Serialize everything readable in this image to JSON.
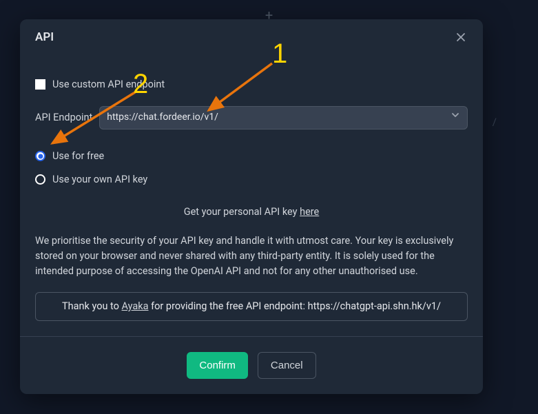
{
  "background": {
    "plus": "+",
    "right_fragment": "/"
  },
  "modal": {
    "title": "API",
    "checkbox_label": "Use custom API endpoint",
    "endpoint_label": "API Endpoint",
    "endpoint_value": "https://chat.fordeer.io/v1/",
    "radio_free": "Use for free",
    "radio_own": "Use your own API key",
    "get_key_text": "Get your personal API key ",
    "get_key_link": "here",
    "desc": "We prioritise the security of your API key and handle it with utmost care. Your key is exclusively stored on your browser and never shared with any third-party entity. It is solely used for the intended purpose of accessing the OpenAI API and not for any other unauthorised use.",
    "thanks_pre": "Thank you to ",
    "thanks_name": "Ayaka",
    "thanks_post": " for providing the free API endpoint: https://chatgpt-api.shn.hk/v1/",
    "confirm": "Confirm",
    "cancel": "Cancel"
  },
  "annotations": {
    "num1": "1",
    "num2": "2"
  }
}
